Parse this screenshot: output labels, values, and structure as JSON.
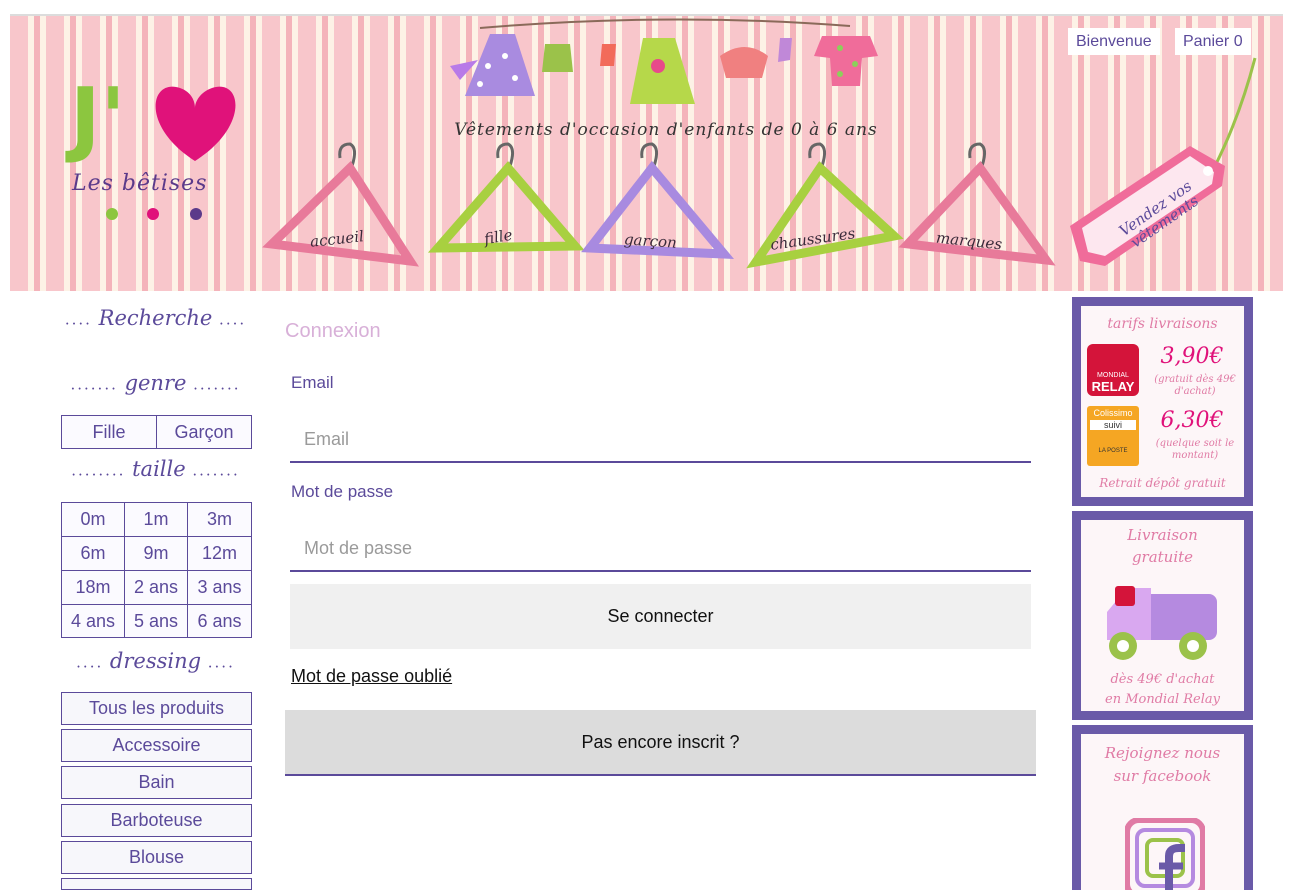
{
  "header": {
    "logo_letter": "J'",
    "logo_subtitle": "Les bêtises",
    "tagline": "Vêtements d'occasion d'enfants de 0 à 6 ans",
    "nav": [
      "accueil",
      "fille",
      "garçon",
      "chaussures",
      "marques"
    ],
    "welcome_label": "Bienvenue",
    "cart_label": "Panier 0",
    "sell_tag": "Vendez vos vêtements"
  },
  "sidebar": {
    "search_title": "Recherche",
    "genre_title": "genre",
    "genres": [
      "Fille",
      "Garçon"
    ],
    "size_title": "taille",
    "sizes": [
      "0m",
      "1m",
      "3m",
      "6m",
      "9m",
      "12m",
      "18m",
      "2 ans",
      "3 ans",
      "4 ans",
      "5 ans",
      "6 ans"
    ],
    "dressing_title": "dressing",
    "categories": [
      "Tous les produits",
      "Accessoire",
      "Bain",
      "Barboteuse",
      "Blouse"
    ]
  },
  "form": {
    "title": "Connexion",
    "email_label": "Email",
    "email_placeholder": "Email",
    "password_label": "Mot de passe",
    "password_placeholder": "Mot de passe",
    "login_button": "Se connecter",
    "forgot_link": "Mot de passe oublié",
    "register_button": "Pas encore inscrit ?"
  },
  "promos": {
    "shipping": {
      "title": "tarifs livraisons",
      "relay_logo_top": "MONDIAL",
      "relay_logo_bottom": "RELAY",
      "relay_price": "3,90€",
      "relay_note": "(gratuit dès 49€ d'achat)",
      "colissimo_logo": "Colissimo",
      "colissimo_suivi": "suivi",
      "colissimo_price": "6,30€",
      "colissimo_note": "(quelque soit le montant)",
      "colissimo_brand": "LA POSTE",
      "footer": "Retrait dépôt gratuit"
    },
    "free_delivery": {
      "title_1": "Livraison",
      "title_2": "gratuite",
      "footer_1": "dès 49€ d'achat",
      "footer_2": "en Mondial Relay"
    },
    "facebook": {
      "title_1": "Rejoignez nous",
      "title_2": "sur facebook"
    }
  },
  "colors": {
    "accent_purple": "#5b4a9a",
    "promo_purple": "#6a5aa8",
    "brand_pink": "#e0127a",
    "brand_green": "#8cc63f"
  }
}
